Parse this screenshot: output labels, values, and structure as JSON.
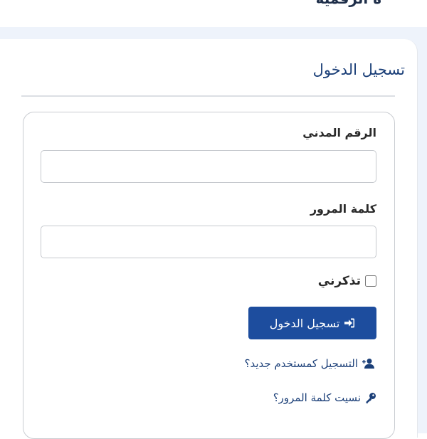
{
  "header": {
    "partial_title": "ة الرقمية"
  },
  "login_card": {
    "title": "تسجيل الدخول"
  },
  "form": {
    "civil_id": {
      "label": "الرقم المدني",
      "value": "",
      "placeholder": ""
    },
    "password": {
      "label": "كلمة المرور",
      "value": "",
      "placeholder": ""
    },
    "remember_me": {
      "label": "تذكرني",
      "checked": false
    },
    "submit_label": "تسجيل الدخول",
    "register_link": "التسجيل كمستخدم جديد؟",
    "forgot_link": "نسيت كلمة المرور؟"
  },
  "icons": {
    "submit": "sign-in-icon",
    "register": "user-plus-icon",
    "forgot": "key-icon"
  },
  "colors": {
    "primary": "#1d4d9e",
    "link": "#1b3f78",
    "page_background": "#eef3fb"
  }
}
